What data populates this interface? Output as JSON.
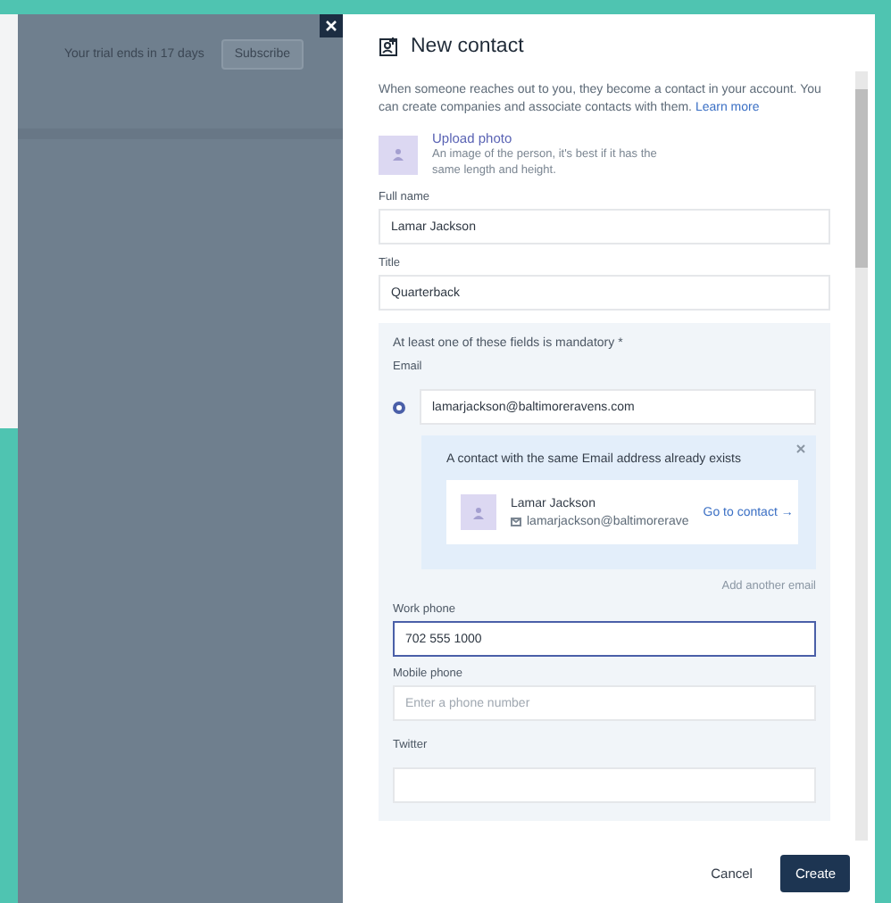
{
  "background": {
    "trial_notice": "Your trial ends in 17 days",
    "subscribe_button": "Subscribe"
  },
  "drawer": {
    "title": "New contact",
    "intro": "When someone reaches out to you, they become a contact in your account. You can create companies and associate contacts with them.",
    "learn_more": "Learn more",
    "photo": {
      "label": "Upload photo",
      "hint": "An image of the person, it's best if it has the same length and height."
    },
    "fields": [
      {
        "label": "Full name",
        "value": "Lamar Jackson"
      },
      {
        "label": "Title",
        "value": "Quarterback"
      }
    ],
    "mandatory_group": {
      "heading": "At least one of these fields is mandatory *",
      "email": {
        "label": "Email",
        "value": "lamarjackson@baltimoreravens.com",
        "primary": true
      },
      "duplicate_notice": {
        "message": "A contact with the same Email address already exists",
        "contact_name": "Lamar Jackson",
        "contact_email": "lamarjackson@baltimorerave",
        "link": "Go to contact →"
      },
      "add_email": "Add another email",
      "phones": [
        {
          "label": "Work phone",
          "value": "702 555 1000",
          "focused": true
        },
        {
          "label": "Mobile phone",
          "placeholder": "Enter a phone number",
          "focused": false
        }
      ],
      "next_label": "Twitter"
    },
    "buttons": {
      "cancel": "Cancel",
      "create": "Create"
    }
  }
}
